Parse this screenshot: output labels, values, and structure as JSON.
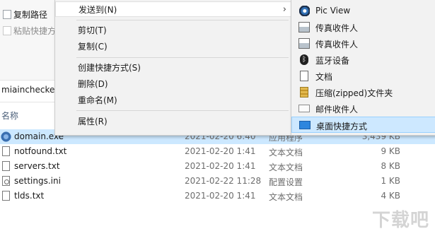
{
  "ribbon": {
    "copy_path": "复制路径",
    "paste_shortcut": "粘贴快捷方式"
  },
  "address": {
    "text": "miainchecker_"
  },
  "columns": {
    "name": "名称"
  },
  "files": [
    {
      "name": "domain.exe",
      "date": "2021-02-20 6:40",
      "type": "应用程序",
      "size": "3,439 KB",
      "icon": "exe-icon",
      "selected": true
    },
    {
      "name": "notfound.txt",
      "date": "2021-02-20 1:41",
      "type": "文本文档",
      "size": "9 KB",
      "icon": "text-file-icon"
    },
    {
      "name": "servers.txt",
      "date": "2021-02-20 1:41",
      "type": "文本文档",
      "size": "8 KB",
      "icon": "text-file-icon"
    },
    {
      "name": "settings.ini",
      "date": "2021-02-22 11:28",
      "type": "配置设置",
      "size": "1 KB",
      "icon": "config-file-icon"
    },
    {
      "name": "tlds.txt",
      "date": "2021-02-20 1:41",
      "type": "文本文档",
      "size": "4 KB",
      "icon": "text-file-icon"
    }
  ],
  "context_menu": {
    "send_to": "发送到(N)",
    "cut": "剪切(T)",
    "copy": "复制(C)",
    "create_shortcut": "创建快捷方式(S)",
    "delete": "删除(D)",
    "rename": "重命名(M)",
    "properties": "属性(R)",
    "arrow": "›"
  },
  "send_to_menu": {
    "items": [
      {
        "label": "Pic View",
        "icon": "picview-icon"
      },
      {
        "label": "传真收件人",
        "icon": "fax-icon"
      },
      {
        "label": "传真收件人",
        "icon": "fax-icon"
      },
      {
        "label": "蓝牙设备",
        "icon": "bluetooth-icon",
        "glyph": "ᛒ"
      },
      {
        "label": "文档",
        "icon": "documents-icon"
      },
      {
        "label": "压缩(zipped)文件夹",
        "icon": "zip-folder-icon"
      },
      {
        "label": "邮件收件人",
        "icon": "mail-icon"
      },
      {
        "label": "桌面快捷方式",
        "icon": "desktop-icon",
        "highlighted": true
      }
    ]
  },
  "colors": {
    "selection": "#cce8ff",
    "menu_bg": "#f2f2f2",
    "submenu_highlight": "#cde8ff"
  }
}
